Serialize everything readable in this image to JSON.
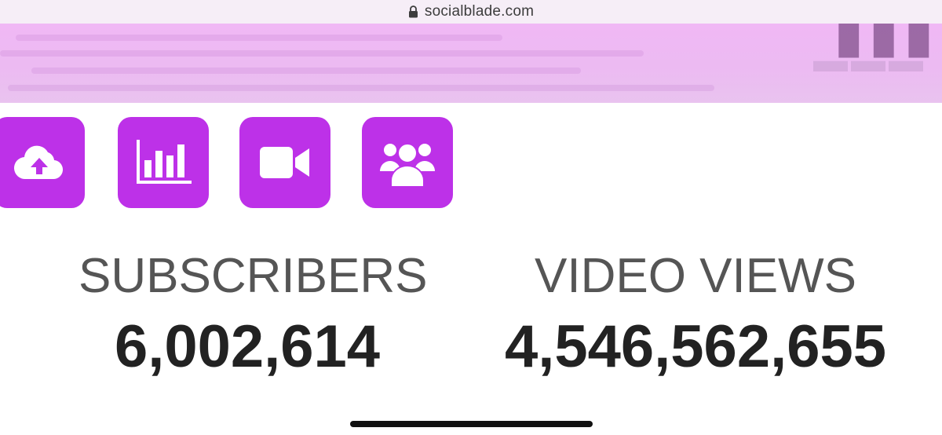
{
  "browser": {
    "url": "socialblade.com"
  },
  "nav": {
    "buttons": [
      {
        "icon": "cloud-upload-icon"
      },
      {
        "icon": "bar-chart-icon"
      },
      {
        "icon": "video-camera-icon"
      },
      {
        "icon": "users-icon"
      }
    ],
    "accent_color": "#bd31e8"
  },
  "stats": {
    "subscribers": {
      "label": "SUBSCRIBERS",
      "value": "6,002,614"
    },
    "video_views": {
      "label": "VIDEO VIEWS",
      "value": "4,546,562,655"
    }
  },
  "colors": {
    "banner": "#eebaf3",
    "label": "#555555",
    "value": "#222222"
  }
}
